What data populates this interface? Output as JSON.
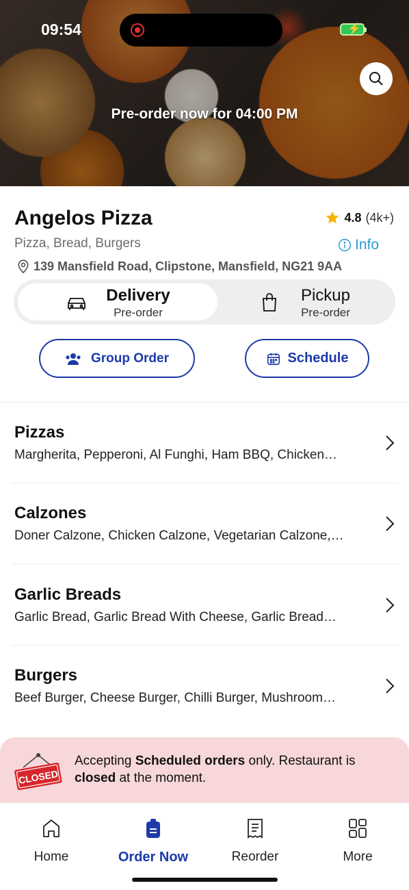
{
  "status_bar": {
    "time": "09:54"
  },
  "hero": {
    "banner": "Pre-order now for 04:00 PM"
  },
  "restaurant": {
    "name": "Angelos Pizza",
    "rating": "4.8",
    "rating_count": "(4k+)",
    "cuisine": "Pizza, Bread, Burgers",
    "info_label": "Info",
    "address": "139 Mansfield Road, Clipstone, Mansfield, NG21 9AA"
  },
  "order_mode": {
    "delivery": {
      "label": "Delivery",
      "sub": "Pre-order",
      "selected": true
    },
    "pickup": {
      "label": "Pickup",
      "sub": "Pre-order",
      "selected": false
    }
  },
  "actions": {
    "group_order": "Group Order",
    "schedule": "Schedule"
  },
  "categories": [
    {
      "title": "Pizzas",
      "items": "Margherita, Pepperoni, Al Funghi, Ham BBQ, Chicken…"
    },
    {
      "title": "Calzones",
      "items": "Doner Calzone, Chicken Calzone, Vegetarian Calzone,…"
    },
    {
      "title": "Garlic Breads",
      "items": "Garlic Bread, Garlic Bread With Cheese, Garlic Bread…"
    },
    {
      "title": "Burgers",
      "items": "Beef Burger, Cheese Burger, Chilli Burger, Mushroom…"
    }
  ],
  "notice": {
    "sign": "CLOSED",
    "part1": "Accepting ",
    "bold1": "Scheduled orders",
    "part2": " only. Restaurant is ",
    "bold2": "closed",
    "part3": " at the moment."
  },
  "nav": {
    "home": "Home",
    "order_now": "Order Now",
    "reorder": "Reorder",
    "more": "More",
    "active": "order_now"
  },
  "colors": {
    "accent": "#1c3aa8",
    "info": "#2b9bd1",
    "star": "#f5b301",
    "notice_bg": "#f7d7d9",
    "closed_red": "#d6262b"
  },
  "icons": [
    "search-icon",
    "star-icon",
    "info-icon",
    "location-pin-icon",
    "car-icon",
    "shopping-bag-icon",
    "group-icon",
    "calendar-icon",
    "chevron-right-icon",
    "closed-sign-icon",
    "home-icon",
    "order-bag-icon",
    "receipt-icon",
    "grid-icon"
  ]
}
